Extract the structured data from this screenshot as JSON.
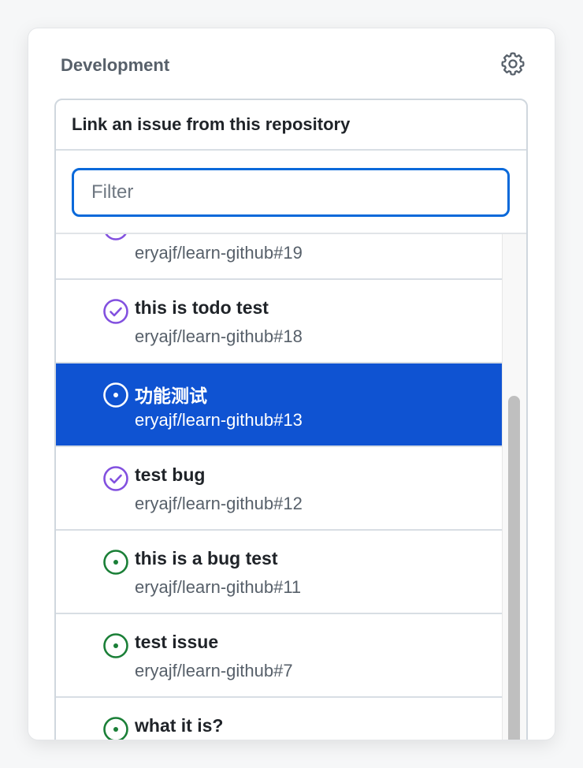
{
  "section": {
    "title": "Development",
    "settings_icon": "gear-icon"
  },
  "panel": {
    "header": "Link an issue from this repository",
    "filter": {
      "placeholder": "Filter",
      "value": ""
    }
  },
  "colors": {
    "selected_bg": "#0f53d2",
    "closed_purple": "#8250df",
    "open_green": "#1a7f37"
  },
  "issues": [
    {
      "title": "",
      "repo": "eryajf/learn-github#19",
      "state": "closed",
      "icon": "check-circle-icon",
      "selected": false
    },
    {
      "title": "this is todo test",
      "repo": "eryajf/learn-github#18",
      "state": "closed",
      "icon": "check-circle-icon",
      "selected": false
    },
    {
      "title": "功能测试",
      "repo": "eryajf/learn-github#13",
      "state": "open",
      "icon": "issue-open-icon",
      "selected": true
    },
    {
      "title": "test bug",
      "repo": "eryajf/learn-github#12",
      "state": "closed",
      "icon": "check-circle-icon",
      "selected": false
    },
    {
      "title": "this is a bug test",
      "repo": "eryajf/learn-github#11",
      "state": "open",
      "icon": "issue-open-icon",
      "selected": false
    },
    {
      "title": "test issue",
      "repo": "eryajf/learn-github#7",
      "state": "open",
      "icon": "issue-open-icon",
      "selected": false
    },
    {
      "title": "what it is?",
      "repo": "",
      "state": "open",
      "icon": "issue-open-icon",
      "selected": false
    }
  ]
}
